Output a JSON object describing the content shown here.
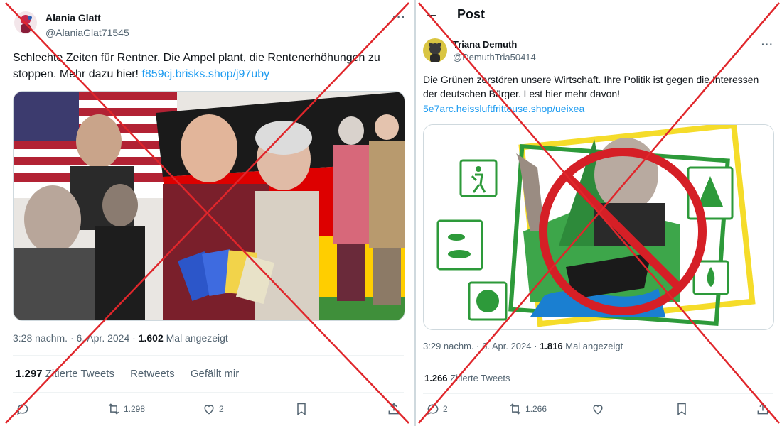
{
  "left_post": {
    "author_name": "Alania Glatt",
    "author_handle": "@AlaniaGlat71545",
    "text": "Schlechte Zeiten für Rentner. Die Ampel plant, die Rentenerhöhungen zu stoppen. Mehr dazu hier!",
    "link": "f859cj.brisks.shop/j97uby",
    "time": "3:28 nachm.",
    "date": "6. Apr. 2024",
    "views_count": "1.602",
    "views_label": "Mal angezeigt",
    "quotes_count": "1.297",
    "quotes_label": "Zitierte Tweets",
    "retweets_label": "Retweets",
    "likes_label": "Gefällt mir",
    "reply_count": "",
    "retweet_count": "1.298",
    "like_count": "2",
    "more_label": "···"
  },
  "right_post": {
    "header_title": "Post",
    "back_label": "←",
    "author_name": "Triana Demuth",
    "author_handle": "@DemuthTria50414",
    "text": "Die Grünen zerstören unsere Wirtschaft. Ihre Politik ist gegen die Interessen der deutschen Bürger. Lest hier mehr davon!",
    "link": "5e7arc.heissluftfritteuse.shop/ueixea",
    "time": "3:29 nachm.",
    "date": "6. Apr. 2024",
    "views_count": "1.816",
    "views_label": "Mal angezeigt",
    "quotes_count": "1.266",
    "quotes_label": "Zitierte Tweets",
    "reply_count": "2",
    "retweet_count": "1.266",
    "like_count": "",
    "more_label": "···"
  },
  "image_meta": {
    "left_media_desc": "collage-german-politicians-pensioners",
    "right_media_desc": "collage-politician-prohibition-sign"
  },
  "icons": [
    "reply-icon",
    "retweet-icon",
    "like-icon",
    "bookmark-icon",
    "share-icon",
    "back-arrow-icon",
    "more-icon"
  ],
  "colors": {
    "cross_red": "#e0262b",
    "link_blue": "#1d9bf0",
    "secondary_text": "#536471"
  }
}
